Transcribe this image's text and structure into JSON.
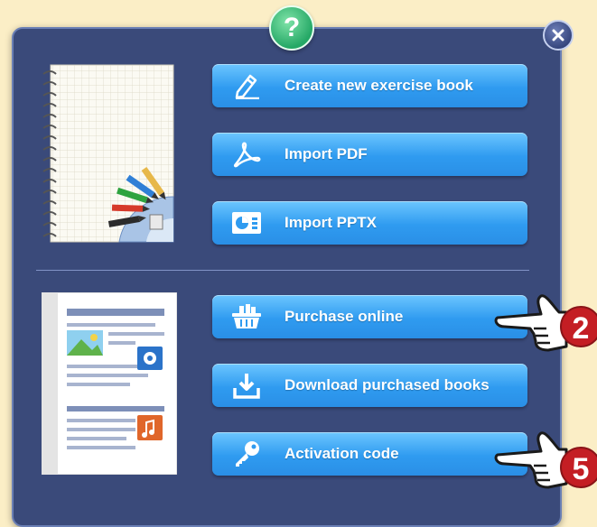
{
  "help": {
    "label": "?",
    "icon": "question-mark-icon"
  },
  "close": {
    "icon": "close-icon"
  },
  "buttons": {
    "create": {
      "label": "Create new exercise book",
      "icon": "pencil-icon"
    },
    "import_pdf": {
      "label": "Import PDF",
      "icon": "pdf-icon"
    },
    "import_pptx": {
      "label": "Import PPTX",
      "icon": "presentation-icon"
    },
    "purchase": {
      "label": "Purchase online",
      "icon": "basket-icon"
    },
    "download": {
      "label": "Download purchased books",
      "icon": "download-icon"
    },
    "activation": {
      "label": "Activation code",
      "icon": "key-icon"
    }
  },
  "callouts": [
    {
      "number": "2",
      "target": "Purchase online"
    },
    {
      "number": "5",
      "target": "Activation code"
    }
  ],
  "colors": {
    "page_bg": "#fbeec6",
    "dialog_bg": "#3a4a7a",
    "button_blue": "#2f9bf0",
    "help_green": "#25a866",
    "callout_red": "#c41e24"
  }
}
